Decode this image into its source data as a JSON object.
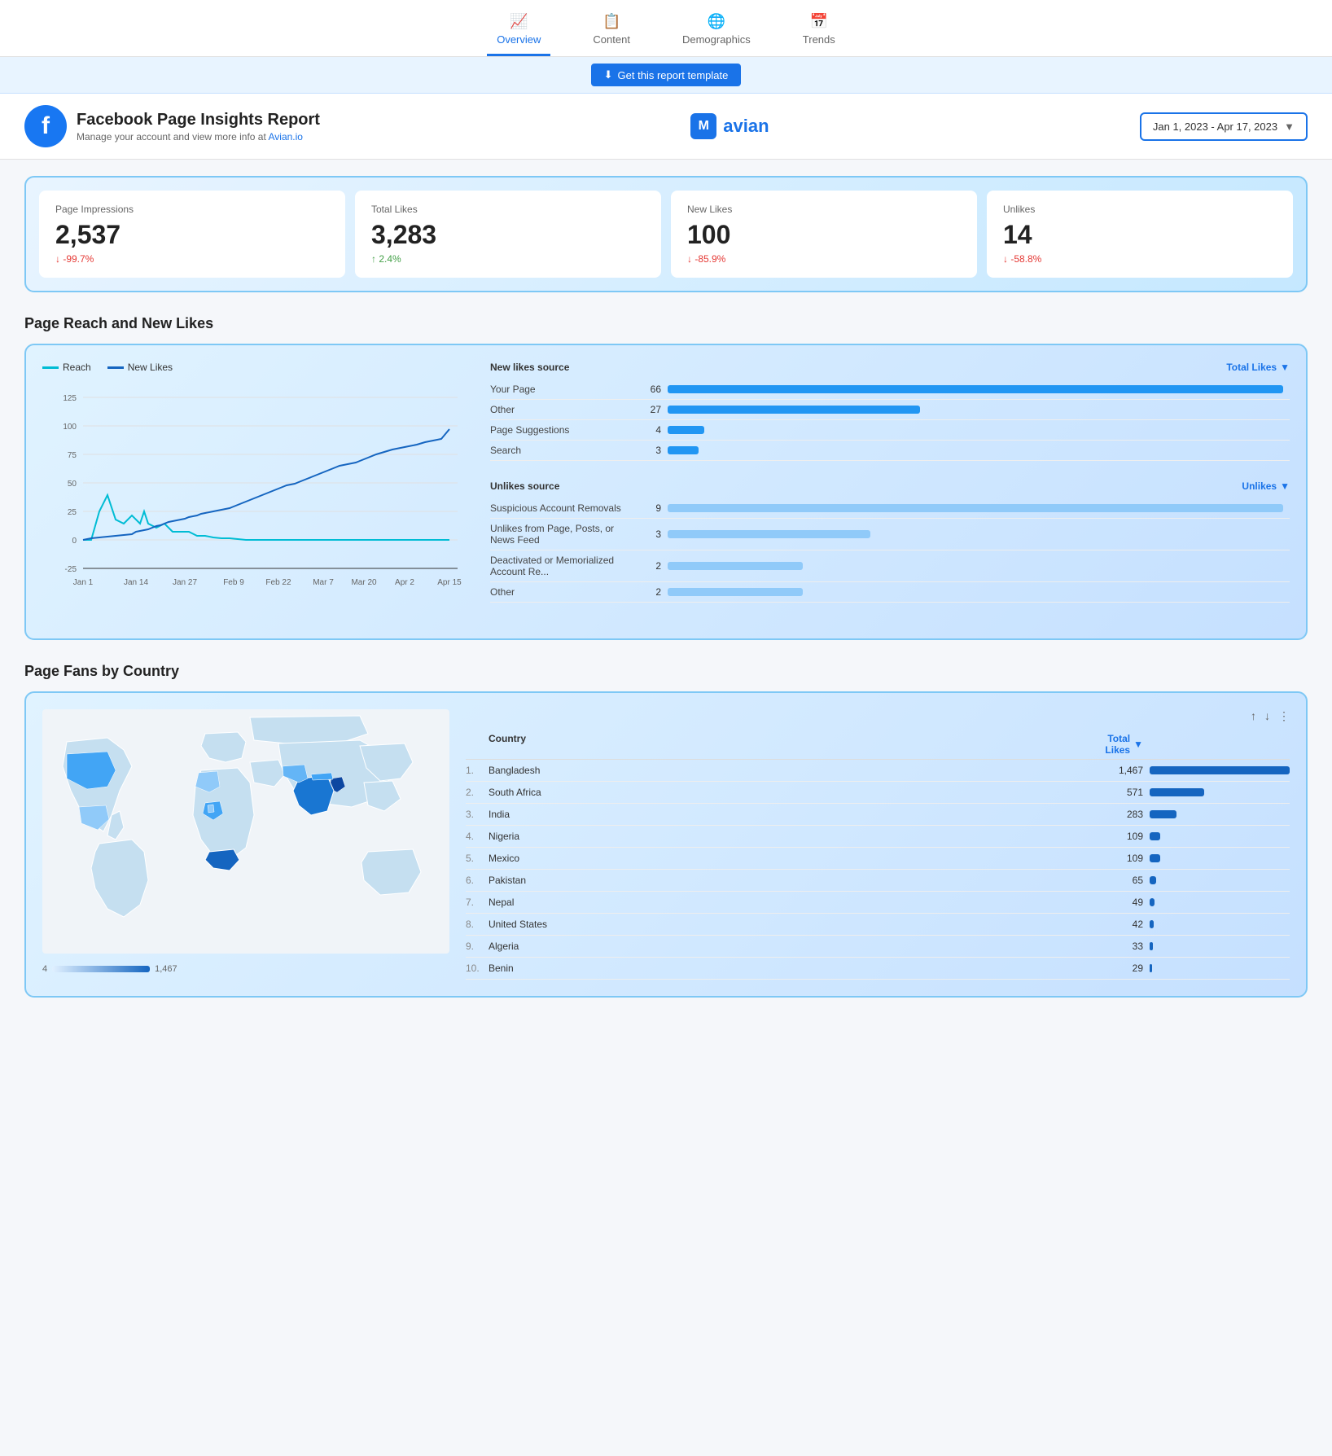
{
  "nav": {
    "items": [
      {
        "label": "Overview",
        "icon": "📈",
        "active": true
      },
      {
        "label": "Content",
        "icon": "📋",
        "active": false
      },
      {
        "label": "Demographics",
        "icon": "🌐",
        "active": false
      },
      {
        "label": "Trends",
        "icon": "📅",
        "active": false
      }
    ]
  },
  "report_banner": {
    "button_label": "Get this report template",
    "icon": "⬇"
  },
  "header": {
    "title": "Facebook Page Insights Report",
    "subtitle": "Manage your account and view more info at",
    "link_text": "Avian.io",
    "logo_text": "avian",
    "date_range": "Jan 1, 2023 - Apr 17, 2023"
  },
  "kpi_cards": [
    {
      "label": "Page Impressions",
      "value": "2,537",
      "change": "↓ -99.7%",
      "change_type": "negative"
    },
    {
      "label": "Total Likes",
      "value": "3,283",
      "change": "↑ 2.4%",
      "change_type": "positive"
    },
    {
      "label": "New Likes",
      "value": "100",
      "change": "↓ -85.9%",
      "change_type": "negative"
    },
    {
      "label": "Unlikes",
      "value": "14",
      "change": "↓ -58.8%",
      "change_type": "negative"
    }
  ],
  "page_reach_section": {
    "title": "Page Reach and New Likes",
    "legend": [
      {
        "label": "Reach",
        "color": "#00bcd4"
      },
      {
        "label": "New Likes",
        "color": "#1565c0"
      }
    ],
    "new_likes_source": {
      "title": "New likes source",
      "col_header": "Total Likes",
      "rows": [
        {
          "label": "Your Page",
          "value": 66,
          "max": 66
        },
        {
          "label": "Other",
          "value": 27,
          "max": 66
        },
        {
          "label": "Page Suggestions",
          "value": 4,
          "max": 66
        },
        {
          "label": "Search",
          "value": 3,
          "max": 66
        }
      ]
    },
    "unlikes_source": {
      "title": "Unlikes source",
      "col_header": "Unlikes",
      "rows": [
        {
          "label": "Suspicious Account Removals",
          "value": 9,
          "max": 9
        },
        {
          "label": "Unlikes from Page, Posts, or News Feed",
          "value": 3,
          "max": 9
        },
        {
          "label": "Deactivated or Memorialized Account Re...",
          "value": 2,
          "max": 9
        },
        {
          "label": "Other",
          "value": 2,
          "max": 9
        }
      ]
    }
  },
  "fans_section": {
    "title": "Page Fans by Country",
    "map_scale_min": "4",
    "map_scale_max": "1,467",
    "col_country": "Country",
    "col_total": "Total Likes",
    "rows": [
      {
        "rank": "1.",
        "country": "Bangladesh",
        "value": 1467,
        "max": 1467
      },
      {
        "rank": "2.",
        "country": "South Africa",
        "value": 571,
        "max": 1467
      },
      {
        "rank": "3.",
        "country": "India",
        "value": 283,
        "max": 1467
      },
      {
        "rank": "4.",
        "country": "Nigeria",
        "value": 109,
        "max": 1467
      },
      {
        "rank": "5.",
        "country": "Mexico",
        "value": 109,
        "max": 1467
      },
      {
        "rank": "6.",
        "country": "Pakistan",
        "value": 65,
        "max": 1467
      },
      {
        "rank": "7.",
        "country": "Nepal",
        "value": 49,
        "max": 1467
      },
      {
        "rank": "8.",
        "country": "United States",
        "value": 42,
        "max": 1467
      },
      {
        "rank": "9.",
        "country": "Algeria",
        "value": 33,
        "max": 1467
      },
      {
        "rank": "10.",
        "country": "Benin",
        "value": 29,
        "max": 1467
      }
    ]
  }
}
